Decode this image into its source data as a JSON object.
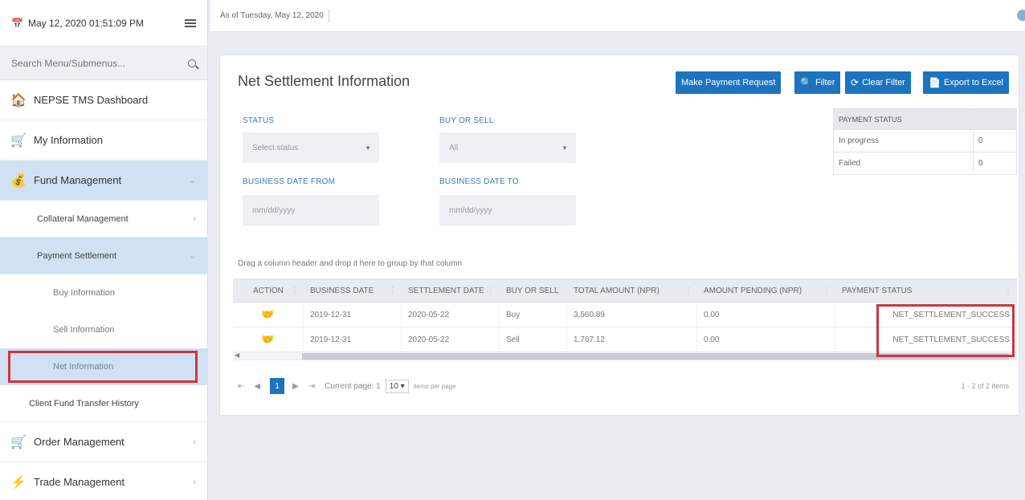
{
  "sidebar": {
    "datetime": "May 12, 2020 01:51:09 PM",
    "search_placeholder": "Search Menu/Submenus...",
    "items": [
      {
        "label": "NEPSE TMS Dashboard"
      },
      {
        "label": "My Information"
      },
      {
        "label": "Fund Management"
      },
      {
        "label": "Collateral Management"
      },
      {
        "label": "Payment Settlement"
      },
      {
        "label": "Buy Information"
      },
      {
        "label": "Sell Information"
      },
      {
        "label": "Net Information"
      },
      {
        "label": "Client Fund Transfer History"
      },
      {
        "label": "Order Management"
      },
      {
        "label": "Trade Management"
      }
    ]
  },
  "topbar": {
    "as_of": "As of Tuesday, May 12, 2020"
  },
  "page": {
    "title": "Net Settlement Information",
    "buttons": {
      "payment_request": "Make Payment Request",
      "filter": "Filter",
      "clear_filter": "Clear Filter",
      "export": "Export to Excel"
    }
  },
  "filters": {
    "status": {
      "label": "STATUS",
      "value": "Select status"
    },
    "buy_or_sell": {
      "label": "BUY OR SELL",
      "value": "All"
    },
    "date_from": {
      "label": "BUSINESS DATE FROM",
      "placeholder": "mm/dd/yyyy"
    },
    "date_to": {
      "label": "BUSINESS DATE TO",
      "placeholder": "mm/dd/yyyy"
    }
  },
  "payment_status_panel": {
    "header": "PAYMENT STATUS",
    "rows": [
      {
        "label": "In progress",
        "count": "0"
      },
      {
        "label": "Failed",
        "count": "0"
      }
    ]
  },
  "grid": {
    "group_hint": "Drag a column header and drop it here to group by that column",
    "columns": [
      "ACTION",
      "BUSINESS DATE",
      "SETTLEMENT DATE",
      "BUY OR SELL",
      "TOTAL AMOUNT (NPR)",
      "AMOUNT PENDING (NPR)",
      "PAYMENT STATUS"
    ],
    "rows": [
      {
        "business_date": "2019-12-31",
        "settlement_date": "2020-05-22",
        "buy_or_sell": "Buy",
        "total_amount": "3,560.89",
        "amount_pending": "0.00",
        "payment_status": "NET_SETTLEMENT_SUCCESS"
      },
      {
        "business_date": "2019-12-31",
        "settlement_date": "2020-05-22",
        "buy_or_sell": "Sell",
        "total_amount": "1,767.12",
        "amount_pending": "0.00",
        "payment_status": "NET_SETTLEMENT_SUCCESS"
      }
    ]
  },
  "pager": {
    "current_page": "1",
    "current_page_text": "Current page: 1",
    "page_size": "10",
    "items_per_page": "items per page",
    "range": "1 - 2 of 2 items"
  },
  "colors": {
    "accent": "#1c73c0",
    "highlight": "#d0343d",
    "active_bg": "#cfe1f3"
  }
}
